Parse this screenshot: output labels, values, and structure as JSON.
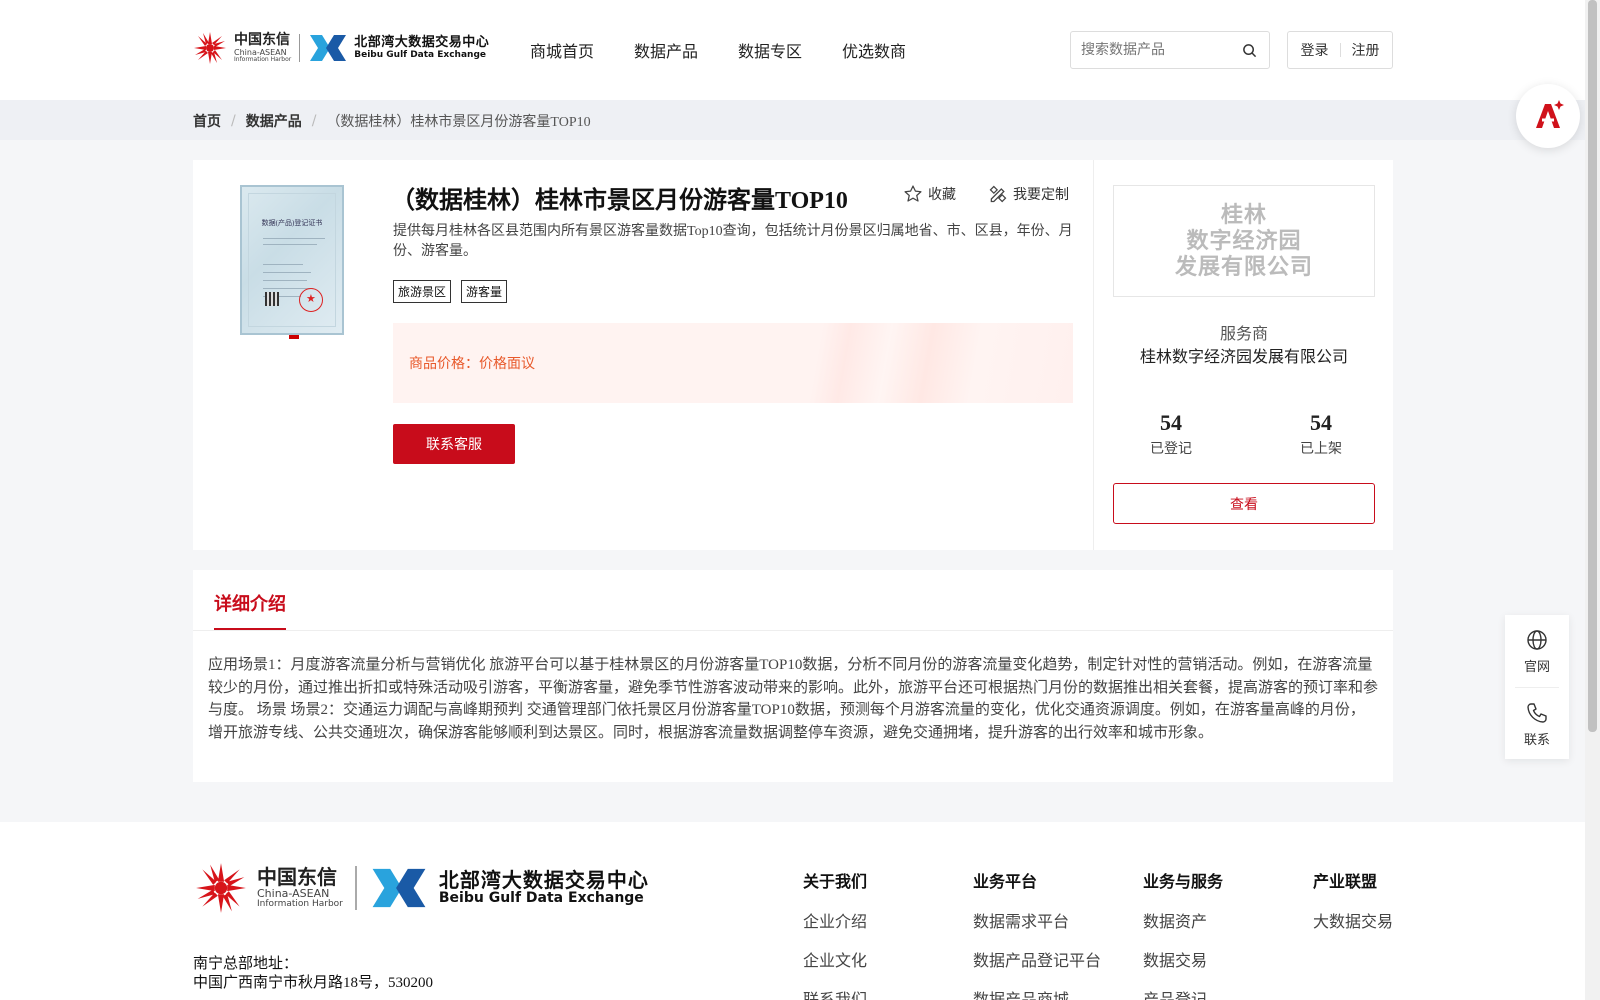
{
  "header": {
    "logo_ct_cn": "中国东信",
    "logo_ct_en_1": "China-ASEAN",
    "logo_ct_en_2": "Information Harbor",
    "logo_bb_cn": "北部湾大数据交易中心",
    "logo_bb_en": "Beibu Gulf Data Exchange",
    "nav": [
      "商城首页",
      "数据产品",
      "数据专区",
      "优选数商"
    ],
    "search_placeholder": "搜索数据产品",
    "login": "登录",
    "register": "注册"
  },
  "breadcrumb": {
    "home": "首页",
    "products": "数据产品",
    "current": "（数据桂林）桂林市景区月份游客量TOP10"
  },
  "product": {
    "title": "（数据桂林）桂林市景区月份游客量TOP10",
    "favorite": "收藏",
    "customize": "我要定制",
    "description": "提供每月桂林各区县范围内所有景区游客量数据Top10查询，包括统计月份景区归属地省、市、区县，年份、月份、游客量。",
    "tags": [
      "旅游景区",
      "游客量"
    ],
    "price_label": "商品价格：",
    "price_value": "价格面议",
    "contact_button": "联系客服",
    "certificate_title": "数据(产品)登记证书"
  },
  "provider": {
    "logo_lines": [
      "桂林",
      "数字经济园",
      "发展有限公司"
    ],
    "label": "服务商",
    "name": "桂林数字经济园发展有限公司",
    "registered_count": "54",
    "registered_label": "已登记",
    "listed_count": "54",
    "listed_label": "已上架",
    "view_button": "查看"
  },
  "detail": {
    "tab": "详细介绍",
    "text": "应用场景1：月度游客流量分析与营销优化 旅游平台可以基于桂林景区的月份游客量TOP10数据，分析不同月份的游客流量变化趋势，制定针对性的营销活动。例如，在游客流量较少的月份，通过推出折扣或特殊活动吸引游客，平衡游客量，避免季节性游客波动带来的影响。此外，旅游平台还可根据热门月份的数据推出相关套餐，提高游客的预订率和参与度。 场景 场景2：交通运力调配与高峰期预判 交通管理部门依托景区月份游客量TOP10数据，预测每个月游客流量的变化，优化交通资源调度。例如，在游客量高峰的月份，增开旅游专线、公共交通班次，确保游客能够顺利到达景区。同时，根据游客流量数据调整停车资源，避免交通拥堵，提升游客的出行效率和城市形象。"
  },
  "floating": {
    "official": "官网",
    "contact": "联系"
  },
  "footer": {
    "columns": [
      {
        "heading": "关于我们",
        "links": [
          "企业介绍",
          "企业文化",
          "联系我们"
        ]
      },
      {
        "heading": "业务平台",
        "links": [
          "数据需求平台",
          "数据产品登记平台",
          "数据产品商城"
        ]
      },
      {
        "heading": "业务与服务",
        "links": [
          "数据资产",
          "数据交易",
          "产品登记"
        ]
      },
      {
        "heading": "产业联盟",
        "links": [
          "大数据交易"
        ]
      }
    ],
    "address_label": "南宁总部地址：",
    "address": "中国广西南宁市秋月路18号，530200"
  },
  "colors": {
    "brand_red": "#c80c1b",
    "price_orange": "#e8592b"
  }
}
